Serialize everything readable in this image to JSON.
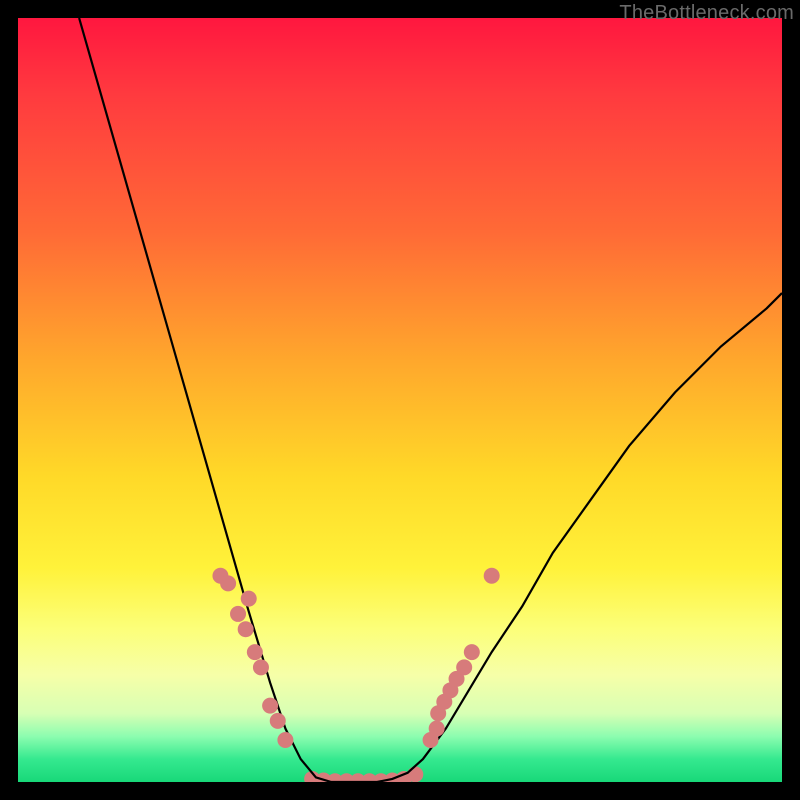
{
  "watermark": "TheBottleneck.com",
  "chart_data": {
    "type": "line",
    "title": "",
    "xlabel": "",
    "ylabel": "",
    "xlim": [
      0,
      100
    ],
    "ylim": [
      0,
      100
    ],
    "grid": false,
    "legend": false,
    "curve_x": [
      8,
      10,
      12,
      14,
      16,
      18,
      20,
      22,
      24,
      26,
      28,
      30,
      31.5,
      33,
      35,
      37,
      39,
      41,
      43,
      45,
      47,
      49,
      51,
      53,
      56,
      59,
      62,
      66,
      70,
      75,
      80,
      86,
      92,
      98,
      100
    ],
    "curve_y": [
      100,
      93,
      86,
      79,
      72,
      65,
      58,
      51,
      44,
      37,
      30,
      23,
      18,
      13,
      7,
      3,
      0.6,
      0,
      0,
      0,
      0,
      0.4,
      1.2,
      3,
      7,
      12,
      17,
      23,
      30,
      37,
      44,
      51,
      57,
      62,
      64
    ],
    "markers": {
      "left_cluster_x": [
        26.5,
        27.5,
        28.8,
        29.8,
        30.2,
        31.0,
        31.8,
        33.0,
        34.0,
        35.0
      ],
      "left_cluster_y": [
        27,
        26,
        22,
        20,
        24,
        17,
        15,
        10,
        8,
        5.5
      ],
      "right_cluster_x": [
        54.0,
        54.8,
        55.0,
        55.8,
        56.6,
        57.4,
        58.4,
        59.4,
        62.0
      ],
      "right_cluster_y": [
        5.5,
        7.0,
        9.0,
        10.5,
        12.0,
        13.5,
        15.0,
        17.0,
        27.0
      ],
      "bottom_cluster_x": [
        38.5,
        40.0,
        41.5,
        43.0,
        44.5,
        46.0,
        47.5,
        49.0,
        50.5,
        52.0
      ],
      "bottom_cluster_y": [
        0.4,
        0.2,
        0.1,
        0.1,
        0.1,
        0.1,
        0.1,
        0.2,
        0.4,
        1.0
      ]
    },
    "gradient_stops": [
      {
        "pos": 0,
        "color": "#ff173f"
      },
      {
        "pos": 10,
        "color": "#ff3a3f"
      },
      {
        "pos": 28,
        "color": "#ff6a36"
      },
      {
        "pos": 45,
        "color": "#ffa82c"
      },
      {
        "pos": 60,
        "color": "#ffd928"
      },
      {
        "pos": 72,
        "color": "#fff23a"
      },
      {
        "pos": 80,
        "color": "#fcff7a"
      },
      {
        "pos": 86,
        "color": "#f6ffa8"
      },
      {
        "pos": 91,
        "color": "#d8ffb4"
      },
      {
        "pos": 94,
        "color": "#8dfdb0"
      },
      {
        "pos": 97,
        "color": "#35e98f"
      },
      {
        "pos": 100,
        "color": "#18d879"
      }
    ],
    "curve_color": "#000000",
    "marker_color": "#d77b7b",
    "marker_radius_px": 8
  }
}
